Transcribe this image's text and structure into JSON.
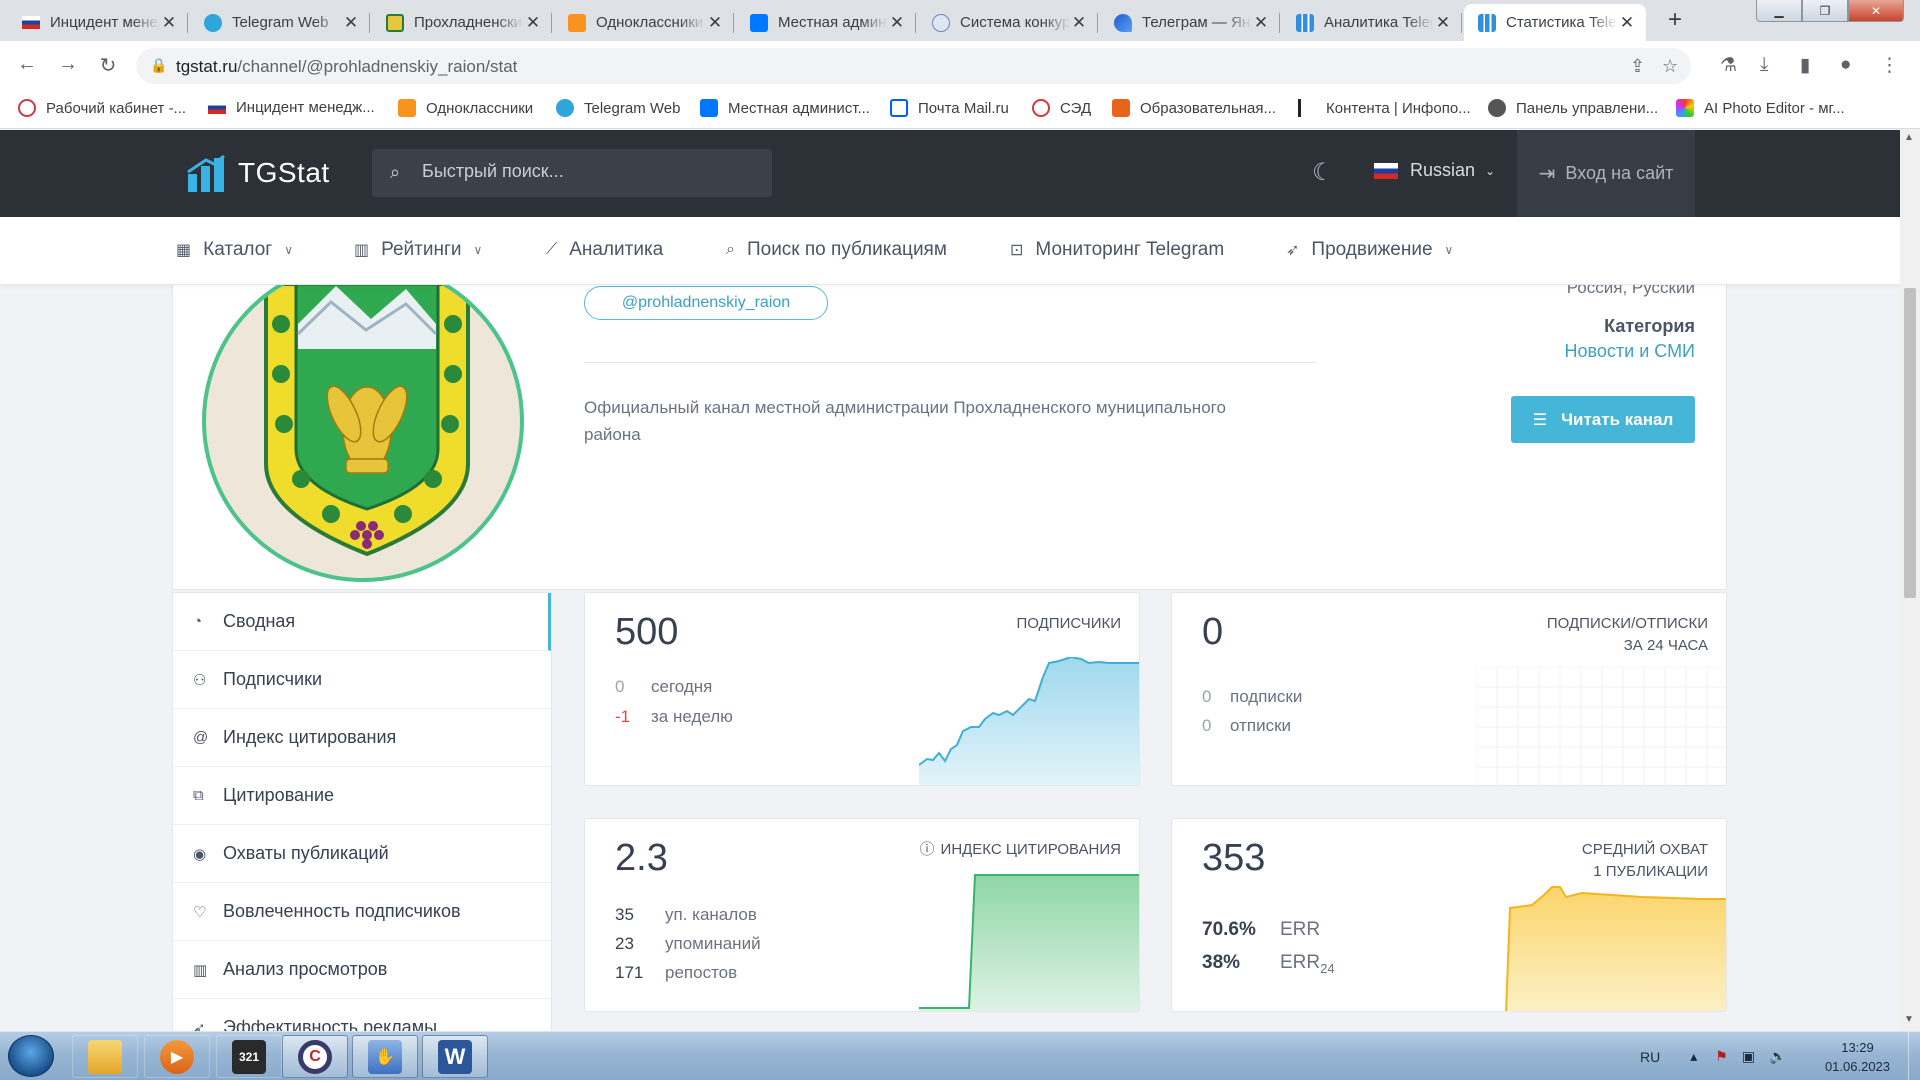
{
  "browser": {
    "tabs": [
      {
        "label": "Инцидент менеджмент",
        "favicon": "flag-russia-icon",
        "active": false
      },
      {
        "label": "Telegram Web",
        "favicon": "telegram-icon",
        "active": false
      },
      {
        "label": "Прохладненский район",
        "favicon": "coat-of-arms-icon",
        "active": false
      },
      {
        "label": "Одноклассники",
        "favicon": "odnoklassniki-icon",
        "active": false
      },
      {
        "label": "Местная администрация",
        "favicon": "vk-icon",
        "active": false
      },
      {
        "label": "Система конкурсов",
        "favicon": "pcb-icon",
        "active": false
      },
      {
        "label": "Телеграм — Яндекс",
        "favicon": "yandex-icon",
        "active": false
      },
      {
        "label": "Аналитика Telegram",
        "favicon": "tgstat-icon",
        "active": false
      },
      {
        "label": "Статистика Telegram",
        "favicon": "tgstat-icon",
        "active": true
      }
    ],
    "url_host": "tgstat.ru",
    "url_path": "/channel/@prohladnenskiy_raion/stat",
    "bookmarks": [
      {
        "label": "Рабочий кабинет -...",
        "favicon": "gosuslugi-icon"
      },
      {
        "label": "Инцидент менедж...",
        "favicon": "flag-russia-icon"
      },
      {
        "label": "Одноклассники",
        "favicon": "odnoklassniki-icon"
      },
      {
        "label": "Telegram Web",
        "favicon": "telegram-icon"
      },
      {
        "label": "Местная админист...",
        "favicon": "vk-icon"
      },
      {
        "label": "Почта Mail.ru",
        "favicon": "mail-icon"
      },
      {
        "label": "СЭД",
        "favicon": "sed-icon"
      },
      {
        "label": "Образовательная...",
        "favicon": "d-icon"
      },
      {
        "label": "Контента | Инфопо...",
        "favicon": "k-icon"
      },
      {
        "label": "Панель управлени...",
        "favicon": "globe-icon"
      },
      {
        "label": "AI Photo Editor - мг...",
        "favicon": "ai-photo-icon"
      }
    ]
  },
  "site": {
    "logo_text": "TGStat",
    "search_placeholder": "Быстрый поиск...",
    "language": "Russian",
    "login_label": "Вход на сайт",
    "nav": [
      {
        "label": "Каталог",
        "icon": "grid-icon",
        "dropdown": true
      },
      {
        "label": "Рейтинги",
        "icon": "bar-chart-icon",
        "dropdown": true
      },
      {
        "label": "Аналитика",
        "icon": "line-chart-icon",
        "dropdown": false
      },
      {
        "label": "Поиск по публикациям",
        "icon": "search-icon",
        "dropdown": false
      },
      {
        "label": "Мониторинг Telegram",
        "icon": "monitor-icon",
        "dropdown": false
      },
      {
        "label": "Продвижение",
        "icon": "rocket-icon",
        "dropdown": true
      }
    ]
  },
  "channel": {
    "username": "@prohladnenskiy_raion",
    "description": "Официальный канал местной администрации Прохладненского муниципального района",
    "geo_language": "Россия, Русский",
    "category_label": "Категория",
    "category_value": "Новости и СМИ",
    "read_button": "Читать канал"
  },
  "sidebar": [
    {
      "label": "Сводная",
      "icon": "dashboard-icon",
      "active": true
    },
    {
      "label": "Подписчики",
      "icon": "users-icon",
      "active": false
    },
    {
      "label": "Индекс цитирования",
      "icon": "at-icon",
      "active": false
    },
    {
      "label": "Цитирование",
      "icon": "quote-icon",
      "active": false
    },
    {
      "label": "Охваты публикаций",
      "icon": "eye-icon",
      "active": false
    },
    {
      "label": "Вовлеченность подписчиков",
      "icon": "heart-icon",
      "active": false
    },
    {
      "label": "Анализ просмотров",
      "icon": "bar-chart-icon",
      "active": false
    },
    {
      "label": "Эффективность рекламы",
      "icon": "rocket-icon",
      "active": false
    }
  ],
  "stats": {
    "subscribers": {
      "value": "500",
      "title": "ПОДПИСЧИКИ",
      "today_value": "0",
      "today_label": "сегодня",
      "week_value": "-1",
      "week_label": "за неделю",
      "color": "#3fb0d3"
    },
    "subs_unsubs": {
      "value": "0",
      "title_line1": "ПОДПИСКИ/ОТПИСКИ",
      "title_line2": "ЗА 24 ЧАСА",
      "subs_value": "0",
      "subs_label": "подписки",
      "unsubs_value": "0",
      "unsubs_label": "отписки"
    },
    "citation": {
      "value": "2.3",
      "title": "ИНДЕКС ЦИТИРОВАНИЯ",
      "rows": [
        {
          "value": "35",
          "label": "уп. каналов"
        },
        {
          "value": "23",
          "label": "упоминаний"
        },
        {
          "value": "171",
          "label": "репостов"
        }
      ],
      "color": "#36b56a"
    },
    "reach": {
      "value": "353",
      "title_line1": "СРЕДНИЙ ОХВАТ",
      "title_line2": "1 ПУБЛИКАЦИИ",
      "err_value": "70.6%",
      "err_label": "ERR",
      "err24_value": "38%",
      "err24_label": "ERR",
      "err24_sub": "24",
      "color": "#f2b51d"
    }
  },
  "taskbar": {
    "language": "RU",
    "time": "13:29",
    "date": "01.06.2023"
  }
}
